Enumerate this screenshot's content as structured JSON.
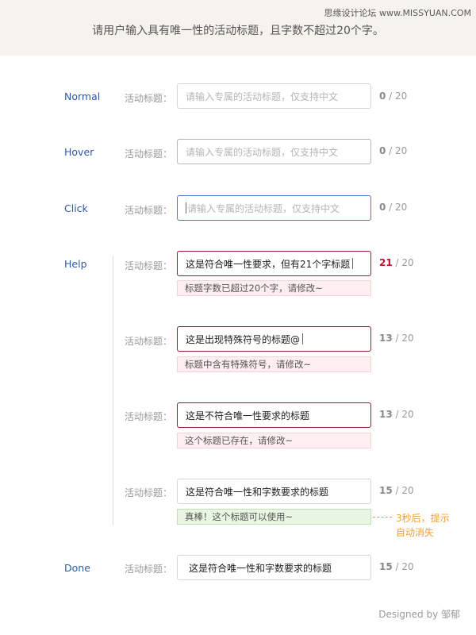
{
  "header": {
    "watermark": "思缘设计论坛 www.MISSYUAN.COM",
    "title": "请用户输入具有唯一性的活动标题，且字数不超过20个字。"
  },
  "field_label": "活动标题：",
  "max_separator": "/ 20",
  "rows": {
    "normal": {
      "state": "Normal",
      "placeholder": "请输入专属的活动标题，仅支持中文",
      "count": "0"
    },
    "hover": {
      "state": "Hover",
      "placeholder": "请输入专属的活动标题，仅支持中文",
      "count": "0"
    },
    "click": {
      "state": "Click",
      "placeholder": "请输入专属的活动标题，仅支持中文",
      "count": "0"
    },
    "help": {
      "state": "Help",
      "items": [
        {
          "value": "这是符合唯一性要求，但有21个字标题",
          "count": "21",
          "message": "标题字数已超过20个字，请修改~"
        },
        {
          "value": "这是出现特殊符号的标题@",
          "count": "13",
          "message": "标题中含有特殊符号，请修改~"
        },
        {
          "value": "这是不符合唯一性要求的标题",
          "count": "13",
          "message": "这个标题已存在，请修改~"
        },
        {
          "value": "这是符合唯一性和字数要求的标题",
          "count": "15",
          "message": "真棒！这个标题可以使用~"
        }
      ],
      "note_line1": "3秒后，提示",
      "note_line2": "自动消失"
    },
    "done": {
      "state": "Done",
      "value": "这是符合唯一性和字数要求的标题",
      "count": "15"
    }
  },
  "footer": "Designed by 邹郁",
  "colors": {
    "state_label": "#2c5aa0",
    "error_border": "#a2182b",
    "over_limit": "#c0112b",
    "focus_border": "#4d79c4",
    "note": "#f0a030"
  }
}
